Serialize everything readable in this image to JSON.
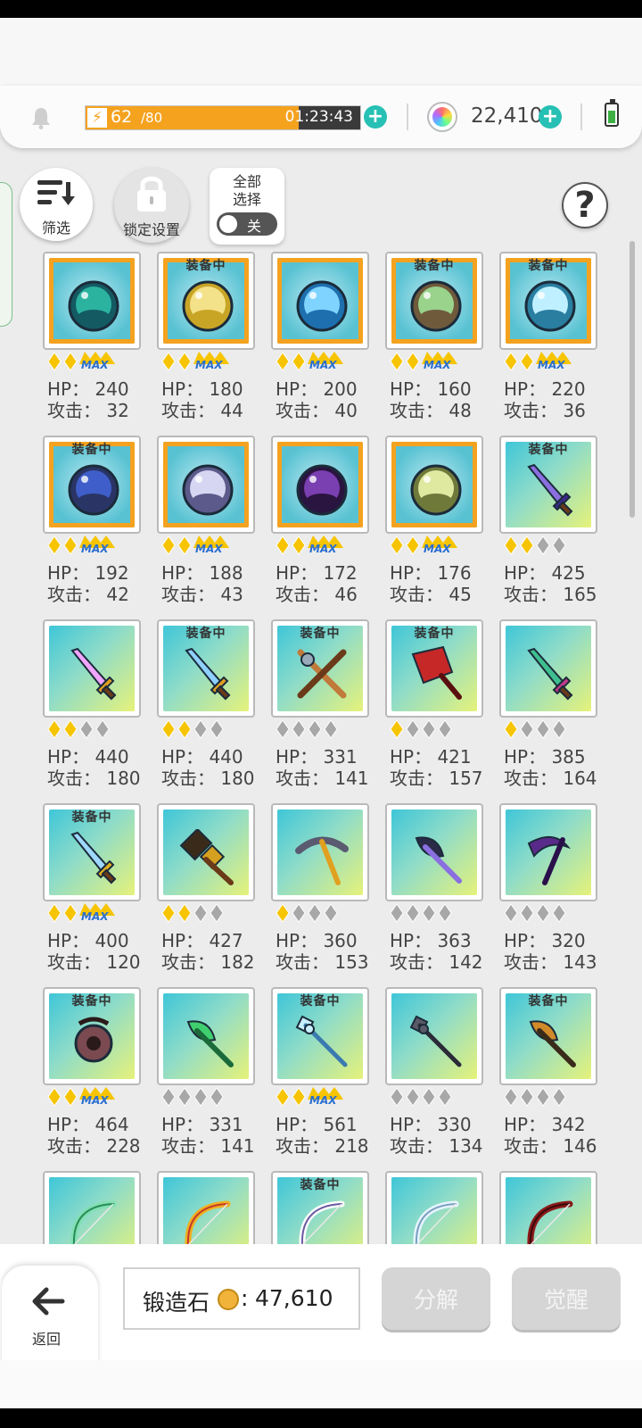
{
  "header": {
    "energy_current": "62",
    "energy_max": "/80",
    "energy_fraction": 0.775,
    "energy_timer": "01:23:43",
    "gem_count": "22,410"
  },
  "toolbar": {
    "filter_label": "筛选",
    "lock_label": "锁定设置",
    "select_all_line1": "全部",
    "select_all_line2": "选择",
    "toggle_state": "关"
  },
  "labels": {
    "equipped": "装备中",
    "hp_prefix": "HP：",
    "atk_prefix": "攻击：",
    "max": "MAX"
  },
  "items": [
    {
      "art": "orb",
      "c1": "#2bb3a0",
      "c2": "#145a63",
      "frame": "gold",
      "equipped": false,
      "stars": "max",
      "hp": "240",
      "atk": "32"
    },
    {
      "art": "orb",
      "c1": "#f4e28a",
      "c2": "#c9a526",
      "frame": "gold",
      "equipped": true,
      "stars": "max",
      "hp": "180",
      "atk": "44"
    },
    {
      "art": "orb",
      "c1": "#7fd4ff",
      "c2": "#1d6fae",
      "frame": "gold",
      "equipped": false,
      "stars": "max",
      "hp": "200",
      "atk": "40"
    },
    {
      "art": "orb",
      "c1": "#9ad38c",
      "c2": "#6f5a3c",
      "frame": "gold",
      "equipped": true,
      "stars": "max",
      "hp": "160",
      "atk": "48"
    },
    {
      "art": "orb",
      "c1": "#bff0ff",
      "c2": "#2a7ea0",
      "frame": "gold",
      "equipped": true,
      "stars": "max",
      "hp": "220",
      "atk": "36"
    },
    {
      "art": "orb",
      "c1": "#3f5ec9",
      "c2": "#2a3566",
      "frame": "gold",
      "equipped": true,
      "stars": "max",
      "hp": "192",
      "atk": "42"
    },
    {
      "art": "orb",
      "c1": "#d6d6f2",
      "c2": "#5c5a8a",
      "frame": "gold",
      "equipped": false,
      "stars": "max",
      "hp": "188",
      "atk": "43"
    },
    {
      "art": "orb",
      "c1": "#7a3fb0",
      "c2": "#2a1440",
      "frame": "gold",
      "equipped": false,
      "stars": "max",
      "hp": "172",
      "atk": "46"
    },
    {
      "art": "orb",
      "c1": "#dfe9a0",
      "c2": "#6f7a3a",
      "frame": "gold",
      "equipped": false,
      "stars": "max",
      "hp": "176",
      "atk": "45"
    },
    {
      "art": "sword",
      "c1": "#8a6fe0",
      "c2": "#3b2a8a",
      "frame": "plain",
      "equipped": true,
      "stars": "2",
      "hp": "425",
      "atk": "165"
    },
    {
      "art": "sword",
      "c1": "#f0a6ff",
      "c2": "#e0a020",
      "frame": "plain",
      "equipped": false,
      "stars": "2",
      "hp": "440",
      "atk": "180"
    },
    {
      "art": "sword",
      "c1": "#8fd0ff",
      "c2": "#e0a020",
      "frame": "plain",
      "equipped": true,
      "stars": "2",
      "hp": "440",
      "atk": "180"
    },
    {
      "art": "cross",
      "c1": "#c07a3a",
      "c2": "#6b3a18",
      "frame": "plain",
      "equipped": true,
      "stars": "0",
      "hp": "331",
      "atk": "141"
    },
    {
      "art": "cleaver",
      "c1": "#c62828",
      "c2": "#5a0f0f",
      "frame": "plain",
      "equipped": true,
      "stars": "1",
      "hp": "421",
      "atk": "157"
    },
    {
      "art": "sword",
      "c1": "#3fbf8f",
      "c2": "#c23a8a",
      "frame": "plain",
      "equipped": false,
      "stars": "1",
      "hp": "385",
      "atk": "164"
    },
    {
      "art": "sword",
      "c1": "#9fd8ff",
      "c2": "#e0b020",
      "frame": "plain",
      "equipped": true,
      "stars": "max",
      "hp": "400",
      "atk": "120"
    },
    {
      "art": "hammer",
      "c1": "#3a2a1a",
      "c2": "#d6a020",
      "frame": "plain",
      "equipped": false,
      "stars": "2",
      "hp": "427",
      "atk": "182"
    },
    {
      "art": "pick",
      "c1": "#5a5a70",
      "c2": "#e0a020",
      "frame": "plain",
      "equipped": false,
      "stars": "1",
      "hp": "360",
      "atk": "153"
    },
    {
      "art": "axe",
      "c1": "#2a2a48",
      "c2": "#8a6fe0",
      "frame": "plain",
      "equipped": false,
      "stars": "0",
      "hp": "363",
      "atk": "142"
    },
    {
      "art": "scythe",
      "c1": "#5a2a8a",
      "c2": "#2a0f4a",
      "frame": "plain",
      "equipped": false,
      "stars": "0",
      "hp": "320",
      "atk": "143"
    },
    {
      "art": "chain",
      "c1": "#7a4a50",
      "c2": "#2a1a1a",
      "frame": "plain",
      "equipped": true,
      "stars": "max",
      "hp": "464",
      "atk": "228"
    },
    {
      "art": "axe",
      "c1": "#3fcf6f",
      "c2": "#1a6a3a",
      "frame": "plain",
      "equipped": false,
      "stars": "0",
      "hp": "331",
      "atk": "141"
    },
    {
      "art": "spear",
      "c1": "#c8f0ff",
      "c2": "#3a7ab0",
      "frame": "plain",
      "equipped": true,
      "stars": "max",
      "hp": "561",
      "atk": "218"
    },
    {
      "art": "spear",
      "c1": "#5a5a68",
      "c2": "#2a2a38",
      "frame": "plain",
      "equipped": false,
      "stars": "0",
      "hp": "330",
      "atk": "134"
    },
    {
      "art": "axe",
      "c1": "#d08a2a",
      "c2": "#3a2a1a",
      "frame": "plain",
      "equipped": true,
      "stars": "0",
      "hp": "342",
      "atk": "146"
    },
    {
      "art": "bow",
      "c1": "#7fe0b0",
      "c2": "#2a8a5a",
      "frame": "plain",
      "equipped": false,
      "stars": "0",
      "hp": "",
      "atk": ""
    },
    {
      "art": "bow",
      "c1": "#f0b020",
      "c2": "#c23a2a",
      "frame": "plain",
      "equipped": false,
      "stars": "0",
      "hp": "",
      "atk": ""
    },
    {
      "art": "bow",
      "c1": "#ffffff",
      "c2": "#6a5aa0",
      "frame": "plain",
      "equipped": true,
      "stars": "0",
      "hp": "",
      "atk": ""
    },
    {
      "art": "bow",
      "c1": "#e8f4ff",
      "c2": "#7aa0c0",
      "frame": "plain",
      "equipped": false,
      "stars": "0",
      "hp": "",
      "atk": ""
    },
    {
      "art": "bow",
      "c1": "#8a1a1a",
      "c2": "#3a0a0a",
      "frame": "plain",
      "equipped": false,
      "stars": "0",
      "hp": "",
      "atk": ""
    }
  ],
  "footer": {
    "back_label": "返回",
    "stone_label": "锻造石",
    "stone_colon": ":",
    "stone_value": "47,610",
    "dismantle_label": "分解",
    "awaken_label": "觉醒"
  },
  "colors": {
    "accent_teal": "#27c0b4",
    "energy_orange": "#f5a21f",
    "star_gold": "#f6c400",
    "star_grey": "#a8a8a8",
    "max_blue": "#2a6fd0"
  }
}
